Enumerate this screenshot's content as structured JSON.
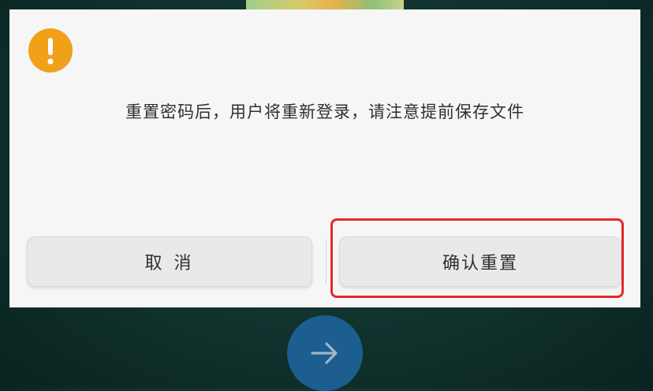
{
  "dialog": {
    "message": "重置密码后，用户将重新登录，请注意提前保存文件",
    "cancel_label": "取 消",
    "confirm_label": "确认重置",
    "icon": "warning-icon"
  },
  "next_button": {
    "icon": "arrow-right-icon"
  },
  "colors": {
    "warning": "#f0a019",
    "highlight": "#e6262b",
    "next_button": "#1b5e8f",
    "dialog_bg": "#f6f6f6"
  }
}
